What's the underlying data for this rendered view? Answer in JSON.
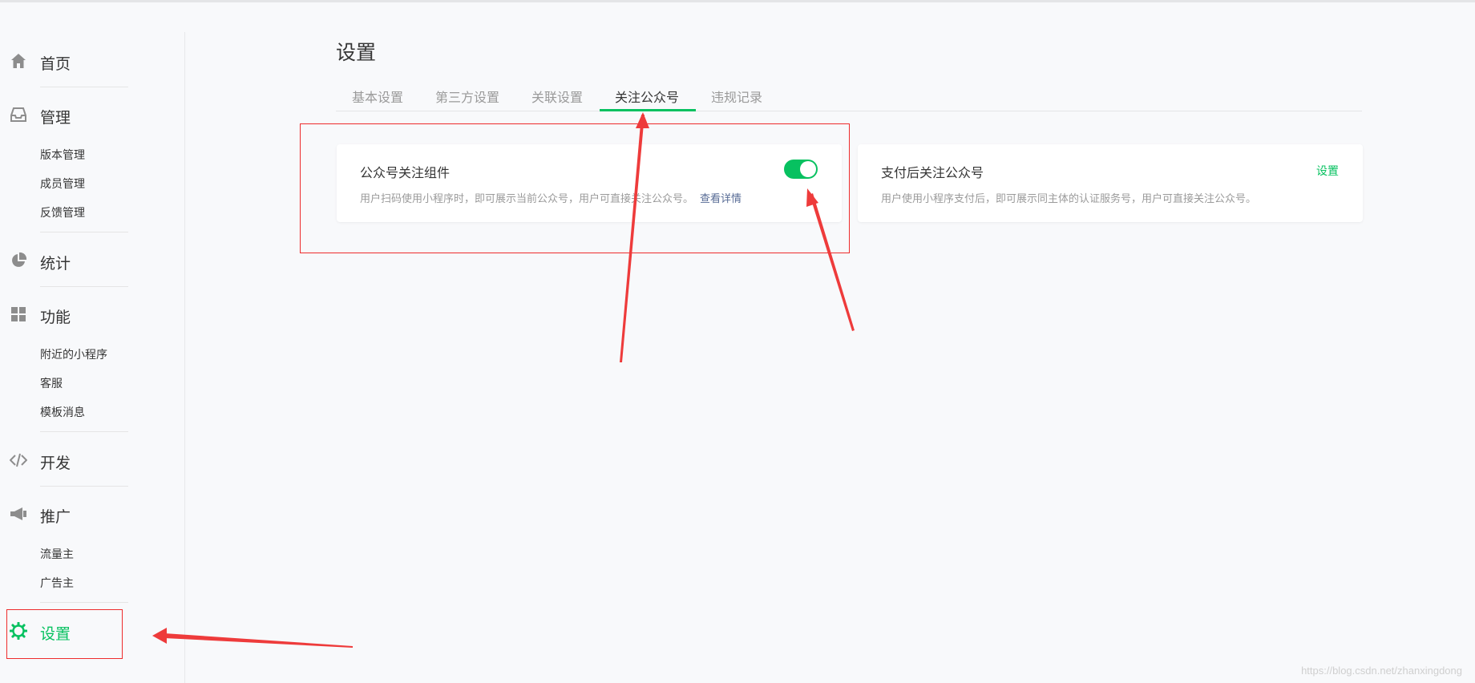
{
  "sidebar": {
    "items": [
      {
        "label": "首页",
        "icon": "home-icon"
      },
      {
        "label": "管理",
        "icon": "inbox-icon",
        "sub": [
          "版本管理",
          "成员管理",
          "反馈管理"
        ]
      },
      {
        "label": "统计",
        "icon": "pie-chart-icon"
      },
      {
        "label": "功能",
        "icon": "grid-icon",
        "sub": [
          "附近的小程序",
          "客服",
          "模板消息"
        ]
      },
      {
        "label": "开发",
        "icon": "code-icon"
      },
      {
        "label": "推广",
        "icon": "megaphone-icon",
        "sub": [
          "流量主",
          "广告主"
        ]
      },
      {
        "label": "设置",
        "icon": "gear-icon",
        "active": true
      }
    ]
  },
  "main": {
    "title": "设置",
    "tabs": [
      {
        "label": "基本设置"
      },
      {
        "label": "第三方设置"
      },
      {
        "label": "关联设置"
      },
      {
        "label": "关注公众号",
        "active": true
      },
      {
        "label": "违规记录"
      }
    ],
    "cards": [
      {
        "title": "公众号关注组件",
        "desc": "用户扫码使用小程序时，即可展示当前公众号，用户可直接关注公众号。",
        "link": "查看详情",
        "toggle_on": true
      },
      {
        "title": "支付后关注公众号",
        "desc": "用户使用小程序支付后，即可展示同主体的认证服务号，用户可直接关注公众号。",
        "action": "设置"
      }
    ]
  },
  "watermark": "https://blog.csdn.net/zhanxingdong",
  "colors": {
    "accent": "#07c160",
    "link": "#576b95",
    "annotation": "#ee2c2c",
    "background": "#f8f9fb"
  }
}
